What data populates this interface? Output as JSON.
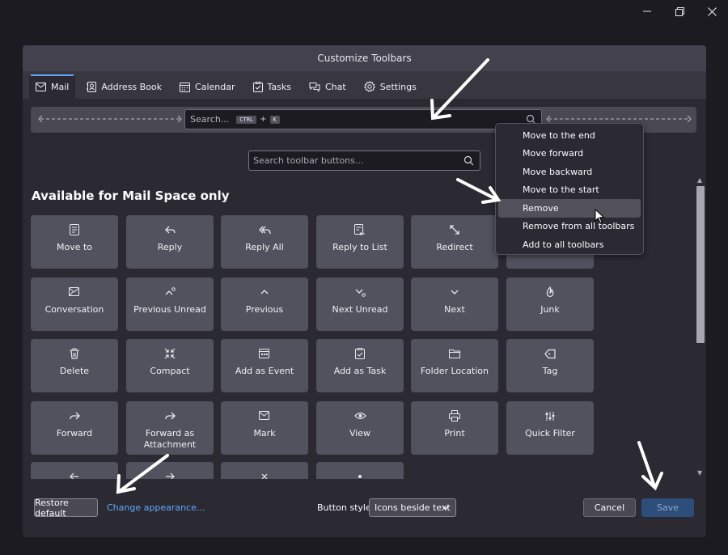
{
  "window": {
    "controls": [
      {
        "name": "minimize-icon"
      },
      {
        "name": "restore-icon"
      },
      {
        "name": "close-icon"
      }
    ]
  },
  "dialog": {
    "title": "Customize Toolbars"
  },
  "tabs": [
    {
      "label": "Mail",
      "icon": "mail-icon",
      "active": true
    },
    {
      "label": "Address Book",
      "icon": "address-book-icon",
      "active": false
    },
    {
      "label": "Calendar",
      "icon": "calendar-icon",
      "active": false
    },
    {
      "label": "Tasks",
      "icon": "tasks-icon",
      "active": false
    },
    {
      "label": "Chat",
      "icon": "chat-icon",
      "active": false
    },
    {
      "label": "Settings",
      "icon": "gear-icon",
      "active": false
    }
  ],
  "toolbar_preview": {
    "search_placeholder": "Search...",
    "shortcut_key1": "CTRL",
    "shortcut_plus": "+",
    "shortcut_key2": "K"
  },
  "filter": {
    "placeholder": "Search toolbar buttons..."
  },
  "section": {
    "heading": "Available for Mail Space only"
  },
  "buttons": [
    {
      "label": "Move to",
      "icon": "move-to-icon"
    },
    {
      "label": "Reply",
      "icon": "reply-icon"
    },
    {
      "label": "Reply All",
      "icon": "reply-all-icon"
    },
    {
      "label": "Reply to List",
      "icon": "reply-list-icon"
    },
    {
      "label": "Redirect",
      "icon": "redirect-icon"
    },
    {
      "label": "Conversation",
      "icon": "conversation-icon"
    },
    {
      "label": "Previous Unread",
      "icon": "previous-unread-icon"
    },
    {
      "label": "Previous",
      "icon": "chevron-up-icon"
    },
    {
      "label": "Next Unread",
      "icon": "next-unread-icon"
    },
    {
      "label": "Next",
      "icon": "chevron-down-icon"
    },
    {
      "label": "Junk",
      "icon": "junk-icon"
    },
    {
      "label": "Delete",
      "icon": "trash-icon"
    },
    {
      "label": "Compact",
      "icon": "compact-icon"
    },
    {
      "label": "Add as Event",
      "icon": "add-event-icon"
    },
    {
      "label": "Add as Task",
      "icon": "add-task-icon"
    },
    {
      "label": "Folder Location",
      "icon": "folder-icon"
    },
    {
      "label": "Tag",
      "icon": "tag-icon"
    },
    {
      "label": "Forward",
      "icon": "forward-icon"
    },
    {
      "label": "Forward as Attachment",
      "icon": "forward-attachment-icon"
    },
    {
      "label": "Mark",
      "icon": "mark-icon"
    },
    {
      "label": "View",
      "icon": "eye-icon"
    },
    {
      "label": "Print",
      "icon": "print-icon"
    },
    {
      "label": "Quick Filter",
      "icon": "sliders-icon"
    },
    {
      "label": "",
      "icon": "arrow-left-icon"
    },
    {
      "label": "",
      "icon": "arrow-right-icon"
    },
    {
      "label": "",
      "icon": "x-icon"
    },
    {
      "label": "",
      "icon": "dot-icon"
    }
  ],
  "context_menu": {
    "items": [
      {
        "label": "Move to the end"
      },
      {
        "label": "Move forward"
      },
      {
        "label": "Move backward"
      },
      {
        "label": "Move to the start"
      },
      {
        "label": "Remove",
        "highlighted": true
      },
      {
        "label": "Remove from all toolbars"
      },
      {
        "label": "Add to all toolbars"
      }
    ]
  },
  "footer": {
    "restore_label": "Restore default",
    "change_appearance_label": "Change appearance...",
    "button_style_label": "Button style:",
    "button_style_value": "Icons beside text",
    "cancel_label": "Cancel",
    "save_label": "Save"
  },
  "colors": {
    "accent": "#5fa8ff",
    "save_disabled": "#2d4e7a",
    "tile": "#52515e"
  }
}
